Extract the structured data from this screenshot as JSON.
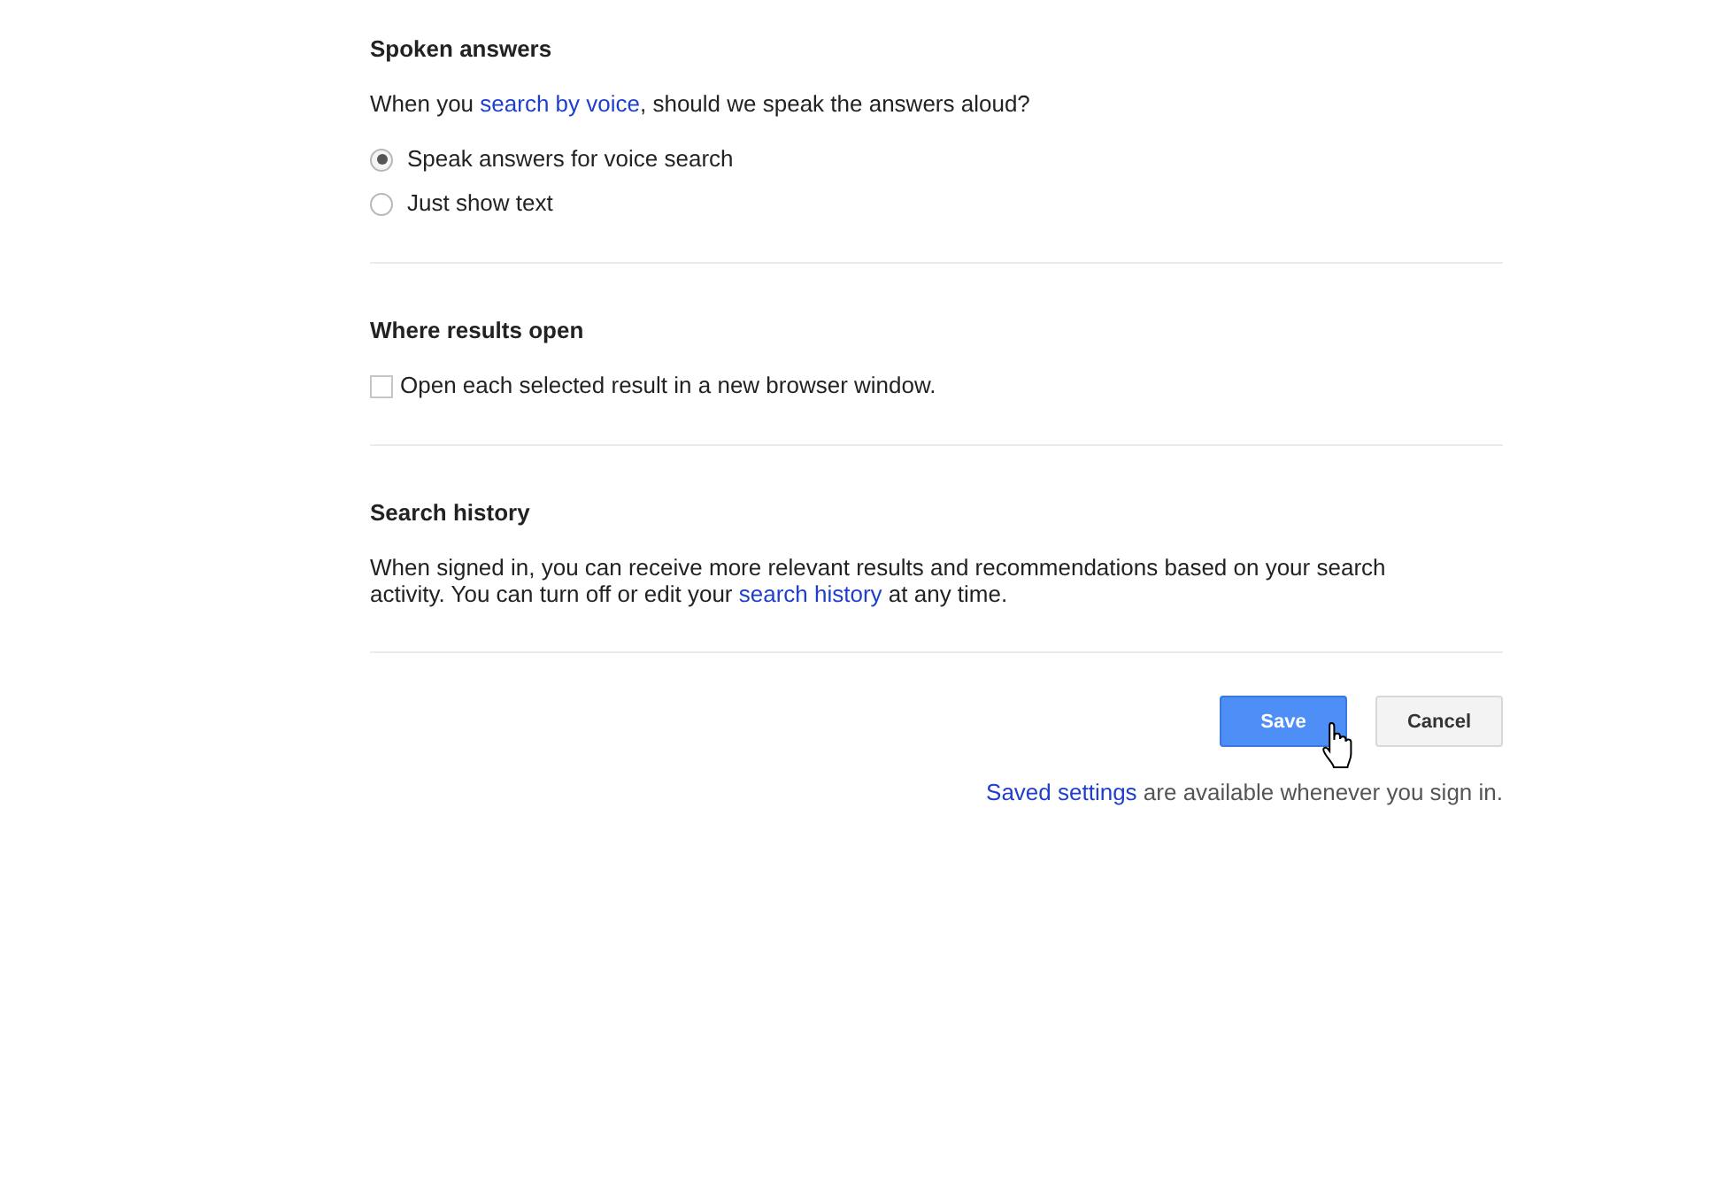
{
  "sections": [
    {
      "title": "Spoken answers",
      "description": {
        "before": "When you ",
        "link": "search by voice",
        "after": ", should we speak the answers aloud?"
      },
      "options": [
        {
          "kind": "radio",
          "label": "Speak answers for voice search",
          "selected": true
        },
        {
          "kind": "radio",
          "label": "Just show text",
          "selected": false
        }
      ]
    },
    {
      "title": "Where results open",
      "options": [
        {
          "kind": "checkbox",
          "label": "Open each selected result in a new browser window.",
          "checked": false
        }
      ]
    },
    {
      "title": "Search history",
      "description": {
        "before": "When signed in, you can receive more relevant results and recommendations based on your search activity. You can turn off or edit your ",
        "link": "search history",
        "after": " at any time."
      }
    }
  ],
  "buttons": [
    {
      "kind": "primary",
      "label": "Save"
    },
    {
      "kind": "secondary",
      "label": "Cancel"
    }
  ],
  "footer": {
    "link": "Saved settings",
    "text": " are available whenever you sign in."
  }
}
